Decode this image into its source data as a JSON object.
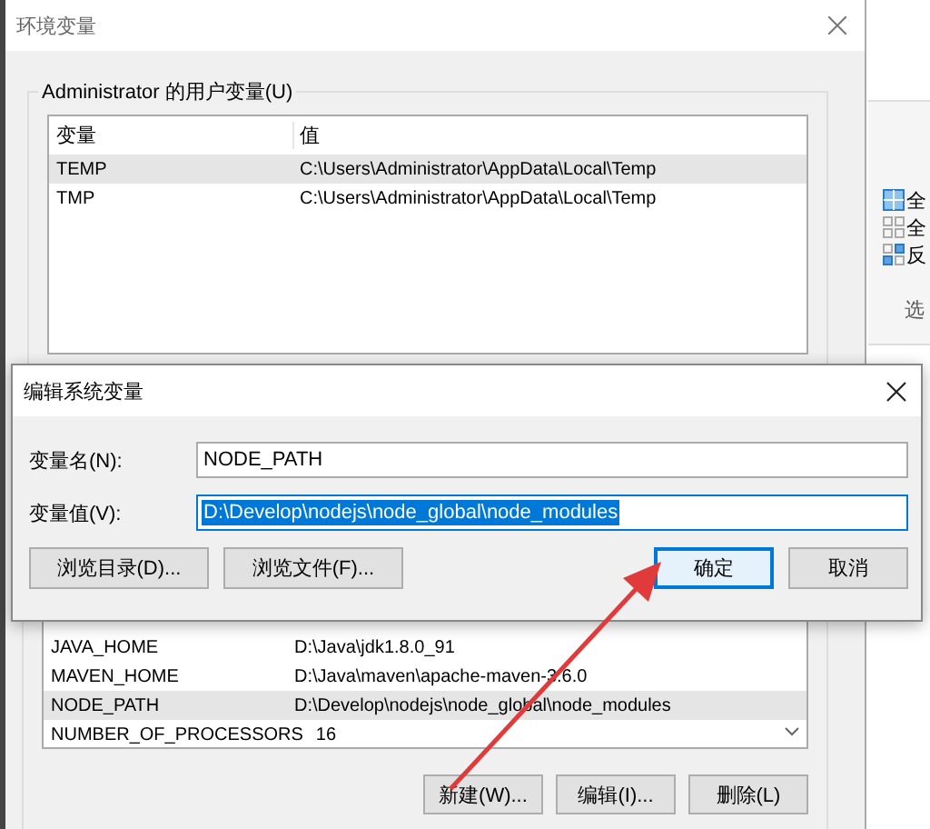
{
  "window": {
    "title": "环境变量"
  },
  "user_variables": {
    "label": "Administrator 的用户变量(U)",
    "columns": [
      "变量",
      "值"
    ],
    "rows": [
      {
        "name": "TEMP",
        "value": "C:\\Users\\Administrator\\AppData\\Local\\Temp",
        "selected": true
      },
      {
        "name": "TMP",
        "value": "C:\\Users\\Administrator\\AppData\\Local\\Temp",
        "selected": false
      }
    ]
  },
  "system_variables": {
    "rows": [
      {
        "name": "JAVA_HOME",
        "value": "D:\\Java\\jdk1.8.0_91",
        "selected": false
      },
      {
        "name": "MAVEN_HOME",
        "value": "D:\\Java\\maven\\apache-maven-3.6.0",
        "selected": false
      },
      {
        "name": "NODE_PATH",
        "value": "D:\\Develop\\nodejs\\node_global\\node_modules",
        "selected": true
      },
      {
        "name": "NUMBER_OF_PROCESSORS",
        "value": "16",
        "selected": false
      }
    ],
    "buttons": [
      "新建(W)...",
      "编辑(I)...",
      "删除(L)"
    ]
  },
  "side_panel": {
    "items": [
      {
        "kind": "select_all",
        "label": "全"
      },
      {
        "kind": "select_none",
        "label": "全"
      },
      {
        "kind": "invert",
        "label": "反"
      }
    ],
    "footer": "选"
  },
  "dialog": {
    "title": "编辑系统变量",
    "fields": [
      {
        "label": "变量名(N):",
        "value": "NODE_PATH",
        "selected": false
      },
      {
        "label": "变量值(V):",
        "value": "D:\\Develop\\nodejs\\node_global\\node_modules",
        "selected": true
      }
    ],
    "buttons": [
      {
        "label": "浏览目录(D)...",
        "focused": false
      },
      {
        "label": "浏览文件(F)...",
        "focused": false
      },
      {
        "label": "确定",
        "focused": true
      },
      {
        "label": "取消",
        "focused": false
      }
    ]
  }
}
